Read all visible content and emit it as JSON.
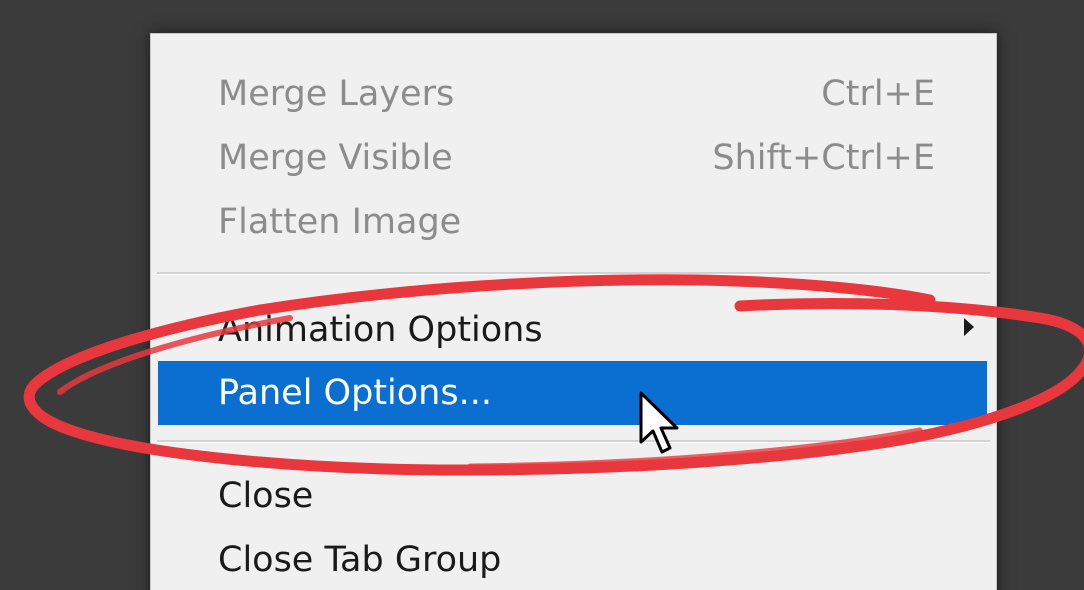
{
  "menu": {
    "items": [
      {
        "label": "Merge Layers",
        "shortcut": "Ctrl+E",
        "state": "disabled"
      },
      {
        "label": "Merge Visible",
        "shortcut": "Shift+Ctrl+E",
        "state": "disabled"
      },
      {
        "label": "Flatten Image",
        "shortcut": "",
        "state": "disabled"
      },
      {
        "label": "Animation Options",
        "shortcut": "",
        "state": "enabled",
        "submenu": true
      },
      {
        "label": "Panel Options...",
        "shortcut": "",
        "state": "highlighted"
      },
      {
        "label": "Close",
        "shortcut": "",
        "state": "enabled"
      },
      {
        "label": "Close Tab Group",
        "shortcut": "",
        "state": "enabled"
      }
    ]
  },
  "colors": {
    "highlight": "#0a6fd1",
    "annotation": "#e8383d",
    "menu_bg": "#f0f0f0",
    "disabled_text": "#8c8c8c",
    "backdrop": "#3b3b3b"
  },
  "icons": {
    "cursor": "mouse-pointer-icon",
    "submenu": "submenu-arrow-icon"
  }
}
